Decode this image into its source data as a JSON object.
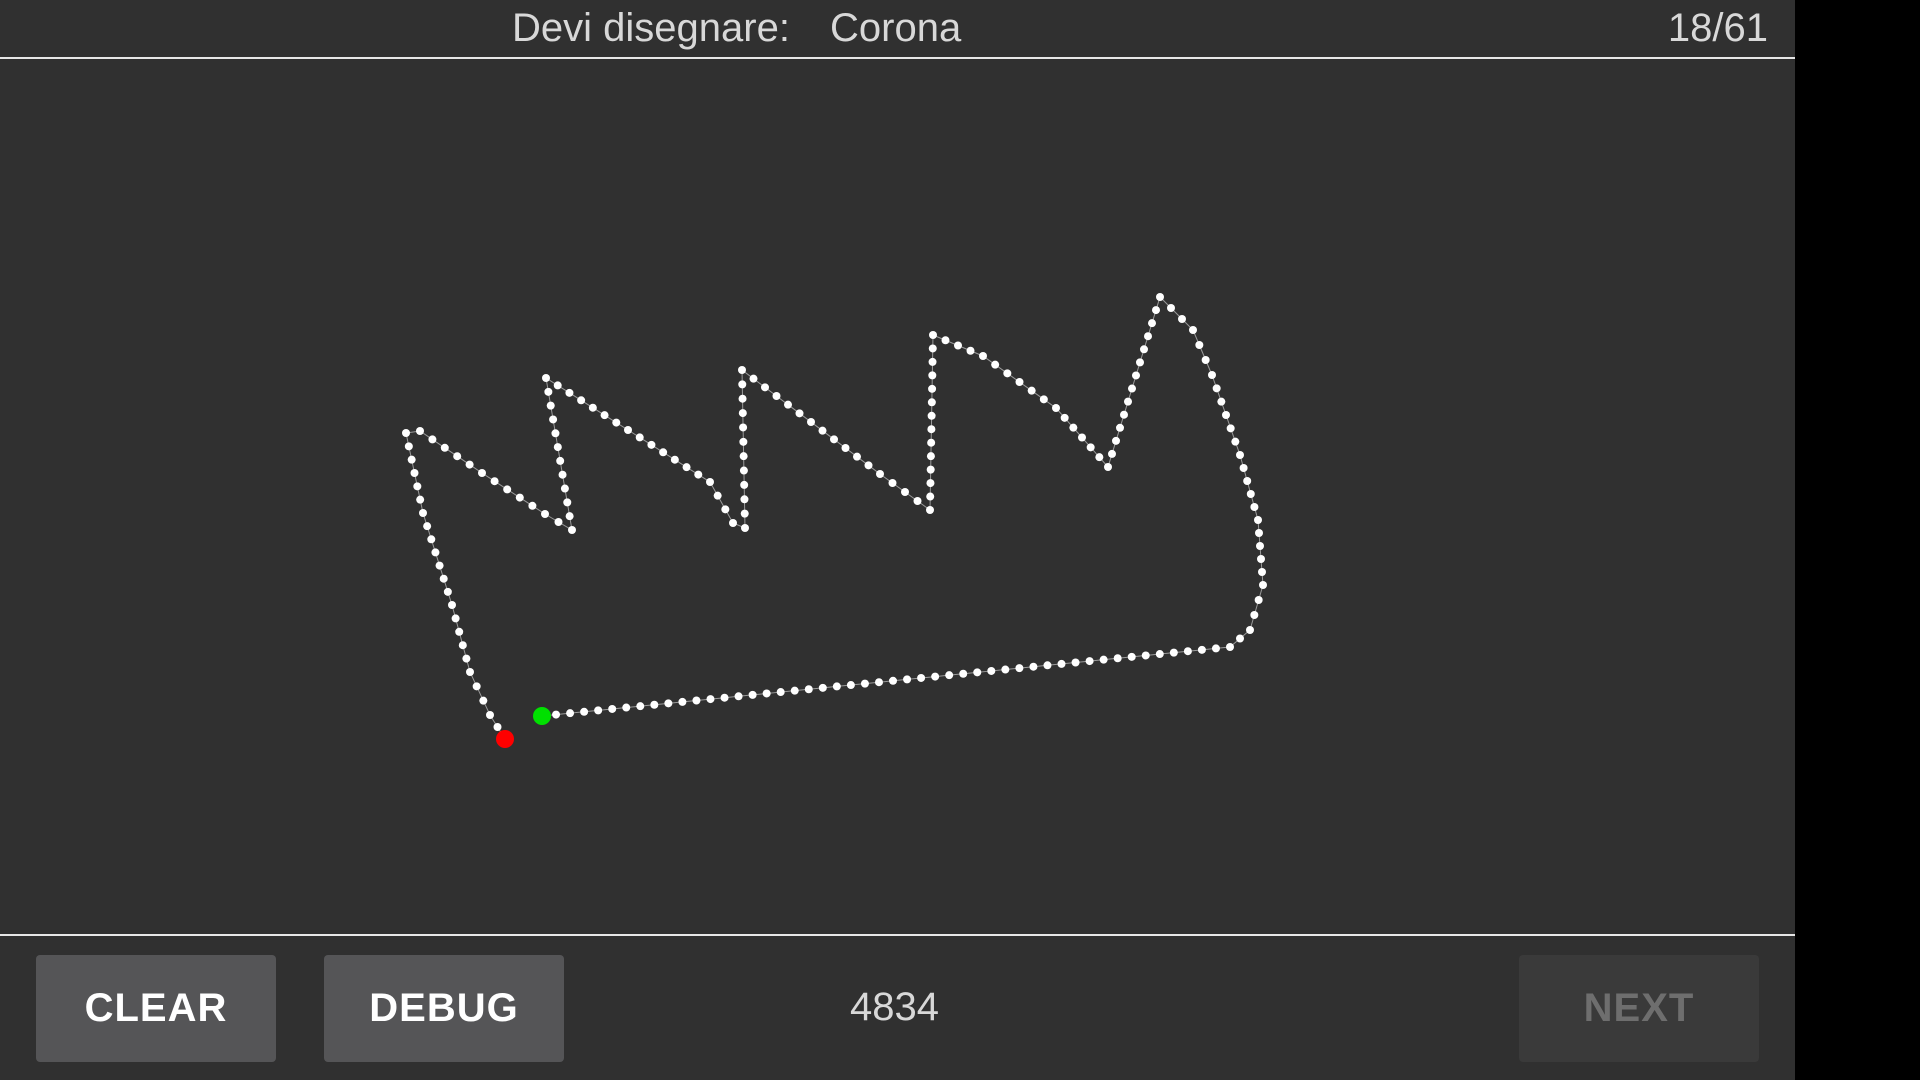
{
  "header": {
    "prompt_label": "Devi disegnare:",
    "prompt_word": "Corona",
    "counter": "18/61"
  },
  "canvas": {
    "stroke_color": "#ffffff",
    "start_marker_color": "#00e000",
    "end_marker_color": "#ff0000"
  },
  "footer": {
    "clear_label": "CLEAR",
    "debug_label": "DEBUG",
    "score": "4834",
    "next_label": "NEXT"
  },
  "colors": {
    "background": "#303030",
    "button": "#555557",
    "button_disabled": "#3a3a3a"
  }
}
